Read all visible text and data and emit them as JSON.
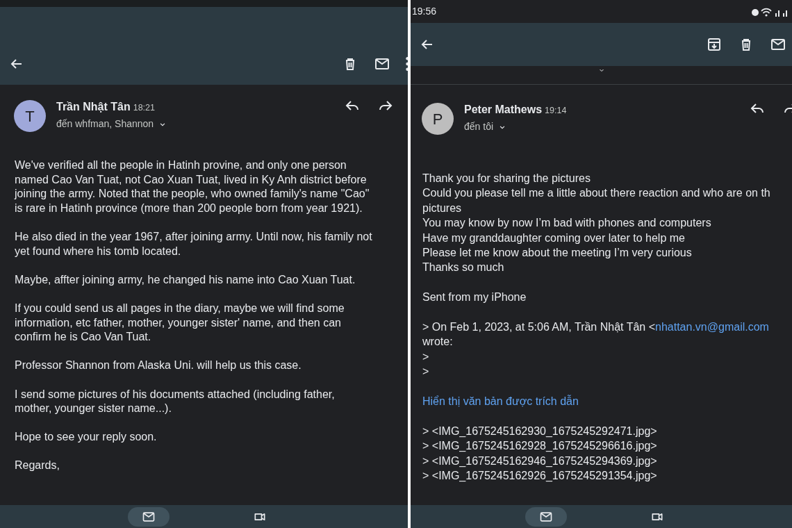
{
  "screens": [
    {
      "actions": [
        {
          "kind": "delete"
        },
        {
          "kind": "mail"
        },
        {
          "kind": "more"
        }
      ],
      "sender": {
        "initial": "T",
        "color": "#9fa8da",
        "name": "Trần Nhật Tân",
        "time": "18:21",
        "recipients": "đến whfman, Shannon"
      },
      "body": [
        {
          "kind": "text",
          "lines": [
            "We've verified all the people in Hatinh provine, and only one person",
            "named Cao Van Tuat, not Cao Xuan Tuat, lived in Ky Anh district before",
            "joining the army. Noted that the people, who owned family's name \"Cao\"",
            "is rare in Hatinh province (more than 200 people born from year 1921)."
          ]
        },
        {
          "kind": "text",
          "lines": [
            "He also died in the year 1967, after joining army. Until now, his family not",
            "yet found where his tomb located."
          ]
        },
        {
          "kind": "text",
          "lines": [
            "Maybe, affter joining army, he changed his name into Cao Xuan Tuat."
          ]
        },
        {
          "kind": "text",
          "lines": [
            "If you could send us all pages in the diary, maybe we will find some",
            "information, etc father, mother, younger sister' name, and then can",
            "confirm he is Cao Van Tuat."
          ]
        },
        {
          "kind": "text",
          "lines": [
            "Professor Shannon from Alaska Uni. will help us this case."
          ]
        },
        {
          "kind": "text",
          "lines": [
            "I send some pictures of his documents attached (including father,",
            "mother, younger sister name...)."
          ]
        },
        {
          "kind": "text",
          "lines": [
            "Hope to see your reply soon."
          ]
        },
        {
          "kind": "text",
          "lines": [
            "Regards,"
          ]
        }
      ],
      "nav": [
        {
          "kind": "mail",
          "selected": true
        },
        {
          "kind": "video",
          "selected": false
        }
      ]
    },
    {
      "status_time": "19:56",
      "actions": [
        {
          "kind": "archive"
        },
        {
          "kind": "delete"
        },
        {
          "kind": "mail"
        }
      ],
      "collapsed_above": true,
      "sender": {
        "initial": "P",
        "color": "#bdbdbd",
        "name": "Peter Mathews",
        "time": "19:14",
        "recipients": "đến tôi"
      },
      "body": [
        {
          "kind": "text",
          "lines": [
            "Thank you for sharing the pictures",
            "Could you please tell me a little about there reaction and who are on th",
            "pictures",
            "You may know by now I’m bad with phones and computers",
            "Have my granddaughter coming over later to help me",
            "Please let me know about the meeting I’m very curious",
            "Thanks so much"
          ]
        },
        {
          "kind": "text",
          "lines": [
            "Sent from my iPhone"
          ]
        },
        {
          "kind": "quote",
          "prefix": "> On Feb 1, 2023, at 5:06 AM, Trần Nhật Tân <",
          "email": "nhattan.vn@gmail.com",
          "lines": [
            "wrote:",
            ">",
            ">"
          ]
        },
        {
          "kind": "link",
          "text": "Hiển thị văn bản được trích dẫn"
        },
        {
          "kind": "text",
          "lines": [
            "> <IMG_1675245162930_1675245292471.jpg>",
            "> <IMG_1675245162928_1675245296616.jpg>",
            "> <IMG_1675245162946_1675245294369.jpg>",
            "> <IMG_1675245162926_1675245291354.jpg>"
          ]
        }
      ],
      "nav": [
        {
          "kind": "mail",
          "selected": true
        },
        {
          "kind": "video",
          "selected": false
        }
      ]
    }
  ]
}
